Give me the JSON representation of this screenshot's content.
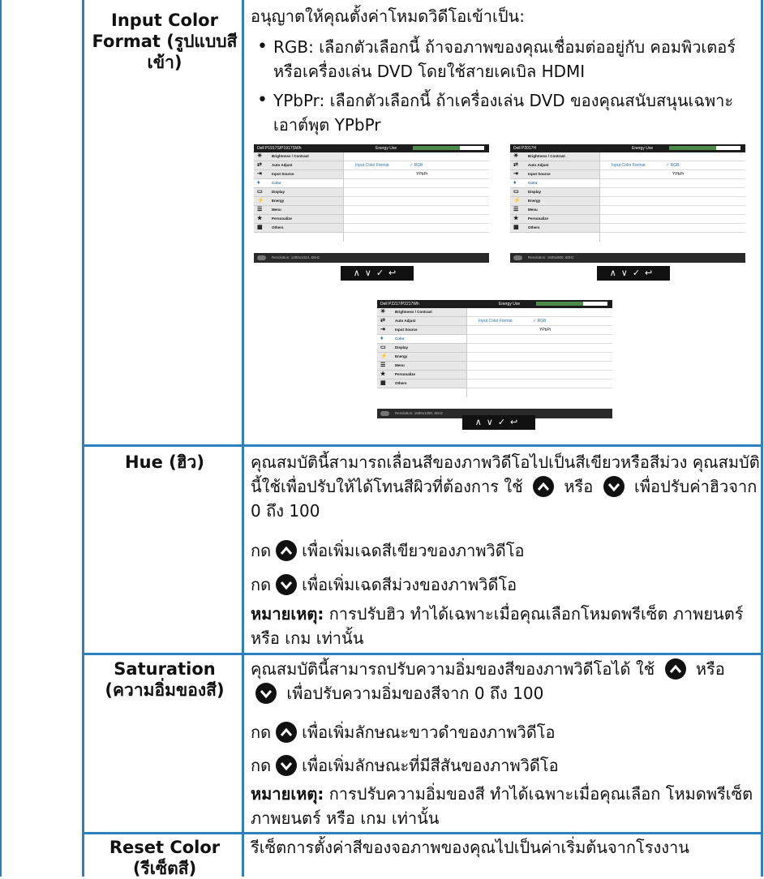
{
  "rows": {
    "input_color_format": {
      "label": "Input Color Format (รูปแบบสีเข้า)",
      "intro": "อนุญาตให้คุณตั้งค่าโหมดวิดีโอเข้าเป็น:",
      "bullet1": "RGB: เลือกตัวเลือกนี้ ถ้าจอภาพของคุณเชื่อมต่ออยู่กับ คอมพิวเตอร์ หรือเครื่องเล่น DVD โดยใช้สายเคเบิล HDMI",
      "bullet2": "YPbPr: เลือกตัวเลือกนี้ ถ้าเครื่องเล่น DVD ของคุณสนับสนุนเฉพาะเอาต์พุต YPbPr"
    },
    "hue": {
      "label": "Hue (ฮิว)",
      "p1a": "คุณสมบัติ​นี้สามารถเลื่อนสีของภาพวิดีโอไปเป็นสีเขียวหรือสีม่วง คุณสมบัตินี้ใช้เพื่อปรับให้ได้โทนสีผิวที่ต้องการ ใช้",
      "p1b": "หรือ",
      "p1c": "เพื่อปรับค่าฮิวจาก 0 ถึง 100",
      "press": "กด",
      "up": "เพื่อเพิ่มเฉดสีเขียวของภาพวิดีโอ",
      "down": "เพื่อเพิ่มเฉดสีม่วงของภาพวิดีโอ",
      "note_label": "หมายเหตุ:",
      "note": "การปรับฮิว ทำได้เฉพาะเมื่อคุณเลือกโหมดพรีเซ็ต ภาพยนตร์ หรือ เกม เท่านั้น"
    },
    "saturation": {
      "label": "Saturation (ความอิ่มของสี)",
      "p1a": "คุณสมบัตินี้สามารถปรับความอิ่มของสีของภาพวิดีโอได้ ใช้",
      "p1b": "หรือ",
      "p1c": "เพื่อปรับความอิ่มของสีจาก 0 ถึง 100",
      "press": "กด",
      "up": "เพื่อเพิ่มลักษณะขาวดำของภาพวิดีโอ",
      "down": "เพื่อเพิ่มลักษณะที่มีสีสันของภาพวิดีโอ",
      "note_label": "หมายเหตุ:",
      "note": "การปรับความอิ่มของสี ทำได้เฉพาะเมื่อคุณเลือก โหมดพรีเซ็ต ภาพยนตร์ หรือ เกม เท่านั้น"
    },
    "reset_color": {
      "label": "Reset Color (รีเซ็ตสี)",
      "text": "รีเซ็ตการตั้งค่าสีของจอภาพของคุณไปเป็นค่าเริ่มต้นจากโรงงาน"
    }
  },
  "osd": {
    "models": [
      "Dell P1917S/P1917SWh",
      "Dell P2017H",
      "Dell P2217/P2217Wh"
    ],
    "energy_use": "Energy Use",
    "menu_items": [
      "Brightness / Contrast",
      "Auto Adjust",
      "Input Source",
      "Color",
      "Display",
      "Energy",
      "Menu",
      "Personalize",
      "Others"
    ],
    "input_color_format": "Input Color Format",
    "option_rgb": "RGB",
    "option_ypbpr": "YPbPr",
    "resolutions": [
      "Resolution: 1280x1024, 60Hz",
      "Resolution: 1600x900, 60Hz",
      "Resolution: 1680x1050, 60Hz"
    ]
  },
  "colors": {
    "border": "#2e7fbd"
  }
}
